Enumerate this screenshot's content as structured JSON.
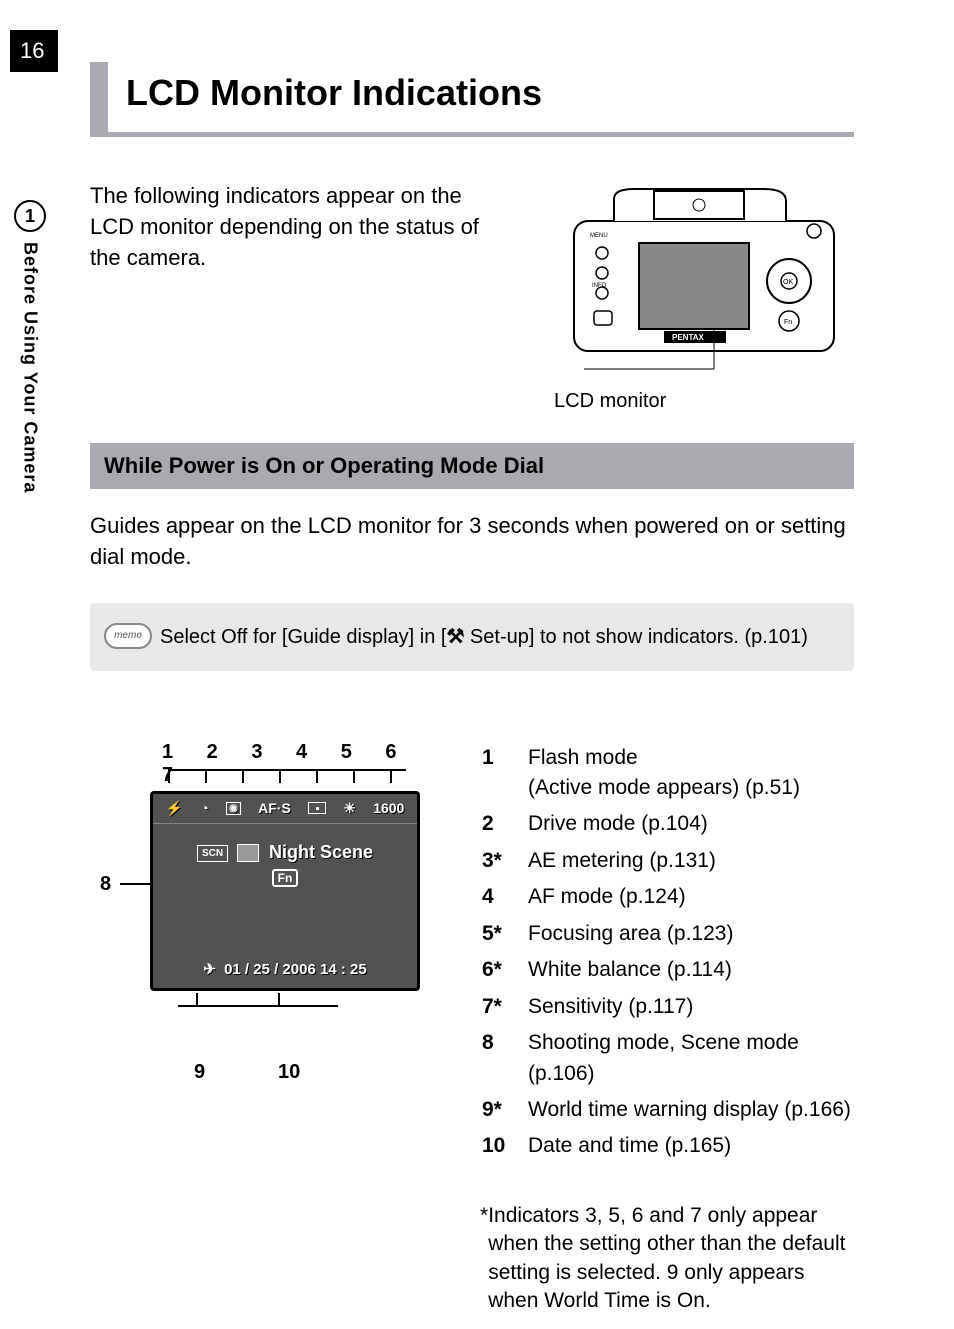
{
  "page_number": "16",
  "side_tab": {
    "number": "1",
    "label": "Before Using Your Camera"
  },
  "heading": "LCD Monitor Indications",
  "intro": "The following indicators appear on the LCD monitor depending on the status of the camera.",
  "camera_caption": "LCD monitor",
  "subheading": "While Power is On or Operating Mode Dial",
  "body": "Guides appear on the LCD monitor for 3 seconds when powered on or setting dial mode.",
  "memo": {
    "label": "memo",
    "before": "Select Off for [Guide display] in [",
    "icon": "⚒",
    "after": " Set-up] to not show indicators. (p.101)"
  },
  "lcd": {
    "top_numbers": "1  2  3  4  5  6  7",
    "afs_label": "AF·S",
    "iso": "1600",
    "scn": "SCN",
    "scene_name": "Night Scene",
    "fn": "Fn",
    "datetime": "01 / 25 / 2006   14 : 25",
    "n8": "8",
    "n9": "9",
    "n10": "10"
  },
  "legend": [
    {
      "n": "1",
      "t": "Flash mode\n(Active mode appears) (p.51)"
    },
    {
      "n": "2",
      "t": "Drive mode (p.104)"
    },
    {
      "n": "3*",
      "t": "AE metering (p.131)"
    },
    {
      "n": "4",
      "t": "AF mode (p.124)"
    },
    {
      "n": "5*",
      "t": "Focusing area (p.123)"
    },
    {
      "n": "6*",
      "t": "White balance (p.114)"
    },
    {
      "n": "7*",
      "t": "Sensitivity (p.117)"
    },
    {
      "n": "8",
      "t": "Shooting mode, Scene mode (p.106)"
    },
    {
      "n": "9*",
      "t": "World time warning display (p.166)"
    },
    {
      "n": "10",
      "t": "Date and time (p.165)"
    }
  ],
  "footnote": "Indicators 3, 5, 6 and 7 only appear when the setting other than the default setting is selected. 9 only appears when World Time is On."
}
